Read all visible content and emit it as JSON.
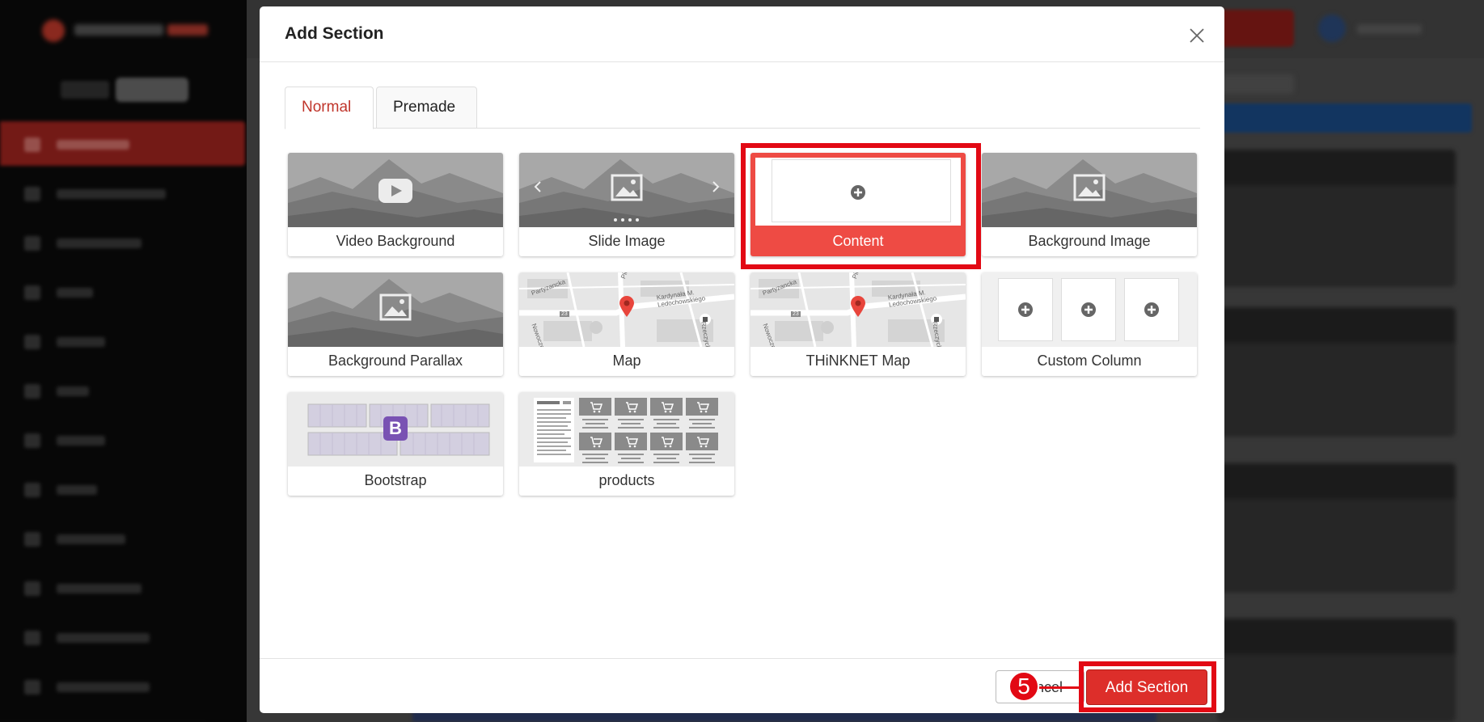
{
  "modal": {
    "title": "Add Section",
    "tabs": [
      {
        "label": "Normal",
        "active": true
      },
      {
        "label": "Premade",
        "active": false
      }
    ],
    "sections": [
      {
        "label": "Video Background",
        "icon": "video-play-icon"
      },
      {
        "label": "Slide Image",
        "icon": "image-slider-icon"
      },
      {
        "label": "Content",
        "icon": "plus-circle-icon",
        "selected": true
      },
      {
        "label": "Background Image",
        "icon": "image-icon"
      },
      {
        "label": "Background Parallax",
        "icon": "image-icon"
      },
      {
        "label": "Map",
        "icon": "map-pin-icon"
      },
      {
        "label": "THiNKNET Map",
        "icon": "map-pin-icon"
      },
      {
        "label": "Custom Column",
        "icon": "columns-icon"
      },
      {
        "label": "Bootstrap",
        "icon": "bootstrap-icon"
      },
      {
        "label": "products",
        "icon": "shopping-cart-icon"
      }
    ],
    "footer": {
      "cancel_label": "Cancel",
      "add_label": "Add Section",
      "step_number": "5"
    }
  },
  "map_labels": {
    "street_1": "Partyzancka",
    "street_2": "Piłsudskiego",
    "street_3": "Kardynała M. Ledochowskiego",
    "street_4": "Rzeczycka",
    "street_5": "Nowoczesna",
    "route": "23"
  },
  "bootstrap_letter": "B",
  "colors": {
    "accent": "#dd2e2a",
    "tab_active": "#c0352b",
    "highlight": "#e20914",
    "selected_card": "#ee4b44",
    "bootstrap": "#7952b3"
  }
}
